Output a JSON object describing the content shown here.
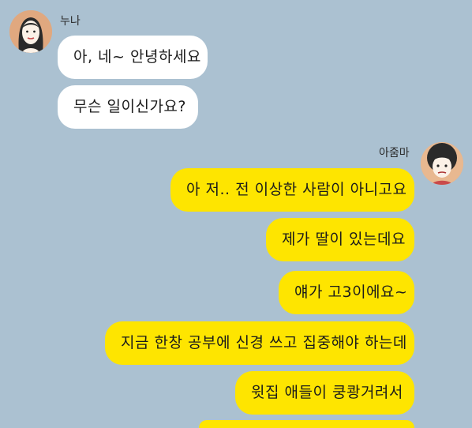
{
  "contacts": {
    "left_name": "누나",
    "right_name": "아줌마"
  },
  "messages": [
    {
      "from": "누나",
      "text": "아, 네~ 안녕하세요"
    },
    {
      "from": "누나",
      "text": "무슨 일이신가요?"
    },
    {
      "from": "아줌마",
      "text": "아 저.. 전 이상한 사람이 아니고요"
    },
    {
      "from": "아줌마",
      "text": "제가 딸이 있는데요"
    },
    {
      "from": "아줌마",
      "text": "얘가 고3이에요~"
    },
    {
      "from": "아줌마",
      "text": "지금 한창 공부에 신경 쓰고 집중해야 하는데"
    },
    {
      "from": "아줌마",
      "text": "윗집 애들이 쿵쾅거려서"
    }
  ],
  "colors": {
    "background": "#abc1d1",
    "incoming_bubble": "#ffffff",
    "outgoing_bubble": "#fee500"
  }
}
